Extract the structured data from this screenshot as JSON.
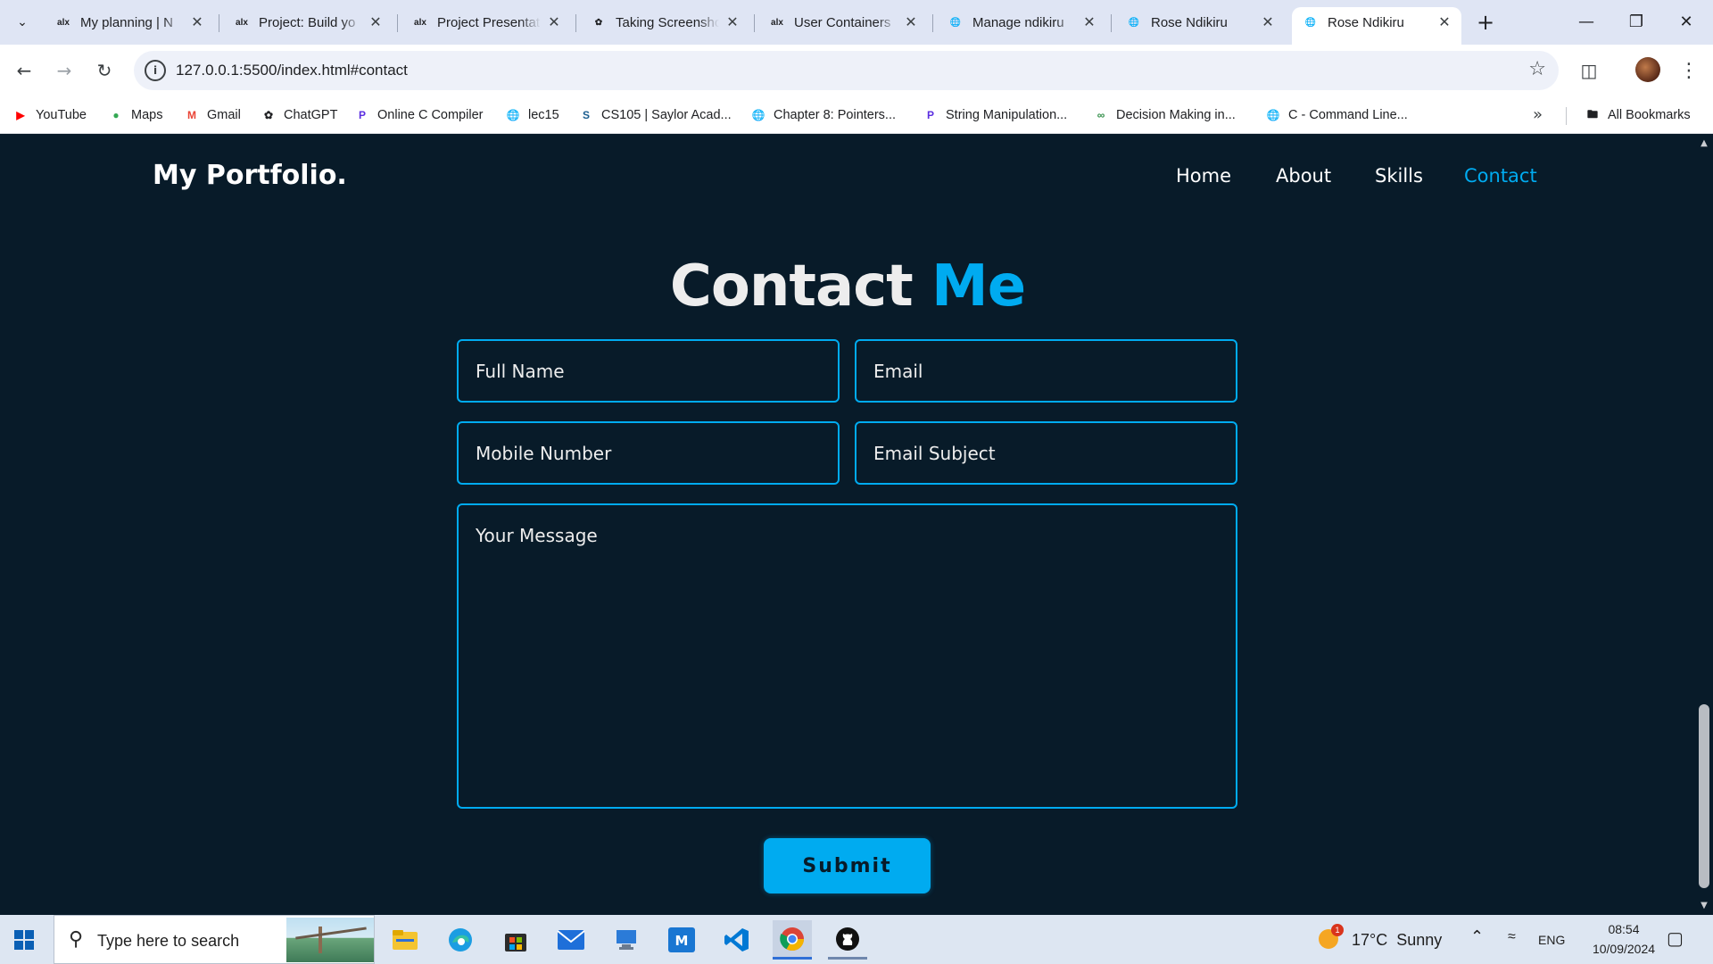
{
  "browser": {
    "tabs": [
      {
        "favicon": "alx",
        "title": "My planning | N",
        "active": false
      },
      {
        "favicon": "alx",
        "title": "Project: Build yo",
        "active": false
      },
      {
        "favicon": "alx",
        "title": "Project Presentat",
        "active": false
      },
      {
        "favicon": "chatgpt",
        "title": "Taking Screensho",
        "active": false
      },
      {
        "favicon": "alx",
        "title": "User Containers",
        "active": false
      },
      {
        "favicon": "globe",
        "title": "Manage ndikiru",
        "active": false
      },
      {
        "favicon": "globe",
        "title": "Rose Ndikiru",
        "active": false
      },
      {
        "favicon": "globe",
        "title": "Rose Ndikiru",
        "active": true
      }
    ],
    "favicon_text_alx": "alx",
    "url": "127.0.0.1:5500/index.html#contact",
    "bookmarks": [
      {
        "icon": "youtube-icon",
        "label": "YouTube"
      },
      {
        "icon": "maps-icon",
        "label": "Maps"
      },
      {
        "icon": "gmail-icon",
        "label": "Gmail"
      },
      {
        "icon": "chatgpt-icon",
        "label": "ChatGPT"
      },
      {
        "icon": "programiz-icon",
        "label": "Online C Compiler"
      },
      {
        "icon": "globe-icon",
        "label": "lec15"
      },
      {
        "icon": "saylor-icon",
        "label": "CS105 | Saylor Acad..."
      },
      {
        "icon": "globe-icon",
        "label": "Chapter 8: Pointers..."
      },
      {
        "icon": "programiz-icon",
        "label": "String Manipulation..."
      },
      {
        "icon": "geeks-icon",
        "label": "Decision Making in..."
      },
      {
        "icon": "globe-icon",
        "label": "C - Command Line..."
      }
    ],
    "all_bookmarks_label": "All Bookmarks"
  },
  "page": {
    "logo": "My Portfolio.",
    "nav": [
      {
        "label": "Home",
        "active": false
      },
      {
        "label": "About",
        "active": false
      },
      {
        "label": "Skills",
        "active": false
      },
      {
        "label": "Contact",
        "active": true
      }
    ],
    "heading_main": "Contact",
    "heading_accent": "Me",
    "form": {
      "full_name_placeholder": "Full Name",
      "email_placeholder": "Email",
      "mobile_placeholder": "Mobile Number",
      "subject_placeholder": "Email Subject",
      "message_placeholder": "Your Message",
      "submit_label": "Submit"
    },
    "colors": {
      "background": "#081b29",
      "accent": "#00abf0",
      "text": "#ededed"
    }
  },
  "taskbar": {
    "search_placeholder": "Type here to search",
    "pinned": [
      "file-explorer-icon",
      "edge-icon",
      "store-icon",
      "mail-icon",
      "remote-desktop-icon",
      "mendeley-icon",
      "vscode-icon",
      "chrome-icon",
      "github-desktop-icon"
    ],
    "weather_badge": "1",
    "weather": "17°C  Sunny",
    "language": "ENG",
    "time": "08:54",
    "date": "10/09/2024"
  }
}
